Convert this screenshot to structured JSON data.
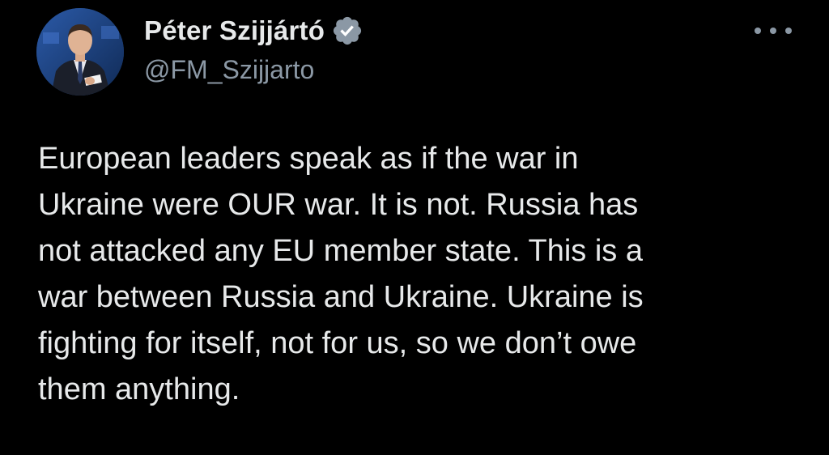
{
  "author": {
    "display_name": "Péter Szijjártó",
    "handle": "@FM_Szijjarto",
    "verified": true,
    "verified_badge_color": "#8b98a5"
  },
  "tweet": {
    "lines": [
      "European leaders speak as if the war in",
      "Ukraine were OUR war. It is not. Russia has",
      "not attacked any EU member state. This is a",
      "war between Russia and Ukraine. Ukraine is",
      "fighting for itself, not for us, so we don’t owe",
      "them anything."
    ]
  },
  "icons": {
    "more": "more-options-icon",
    "verified": "verified-badge-icon"
  },
  "colors": {
    "background": "#000000",
    "text": "#e7e9ea",
    "secondary": "#8b98a5"
  }
}
